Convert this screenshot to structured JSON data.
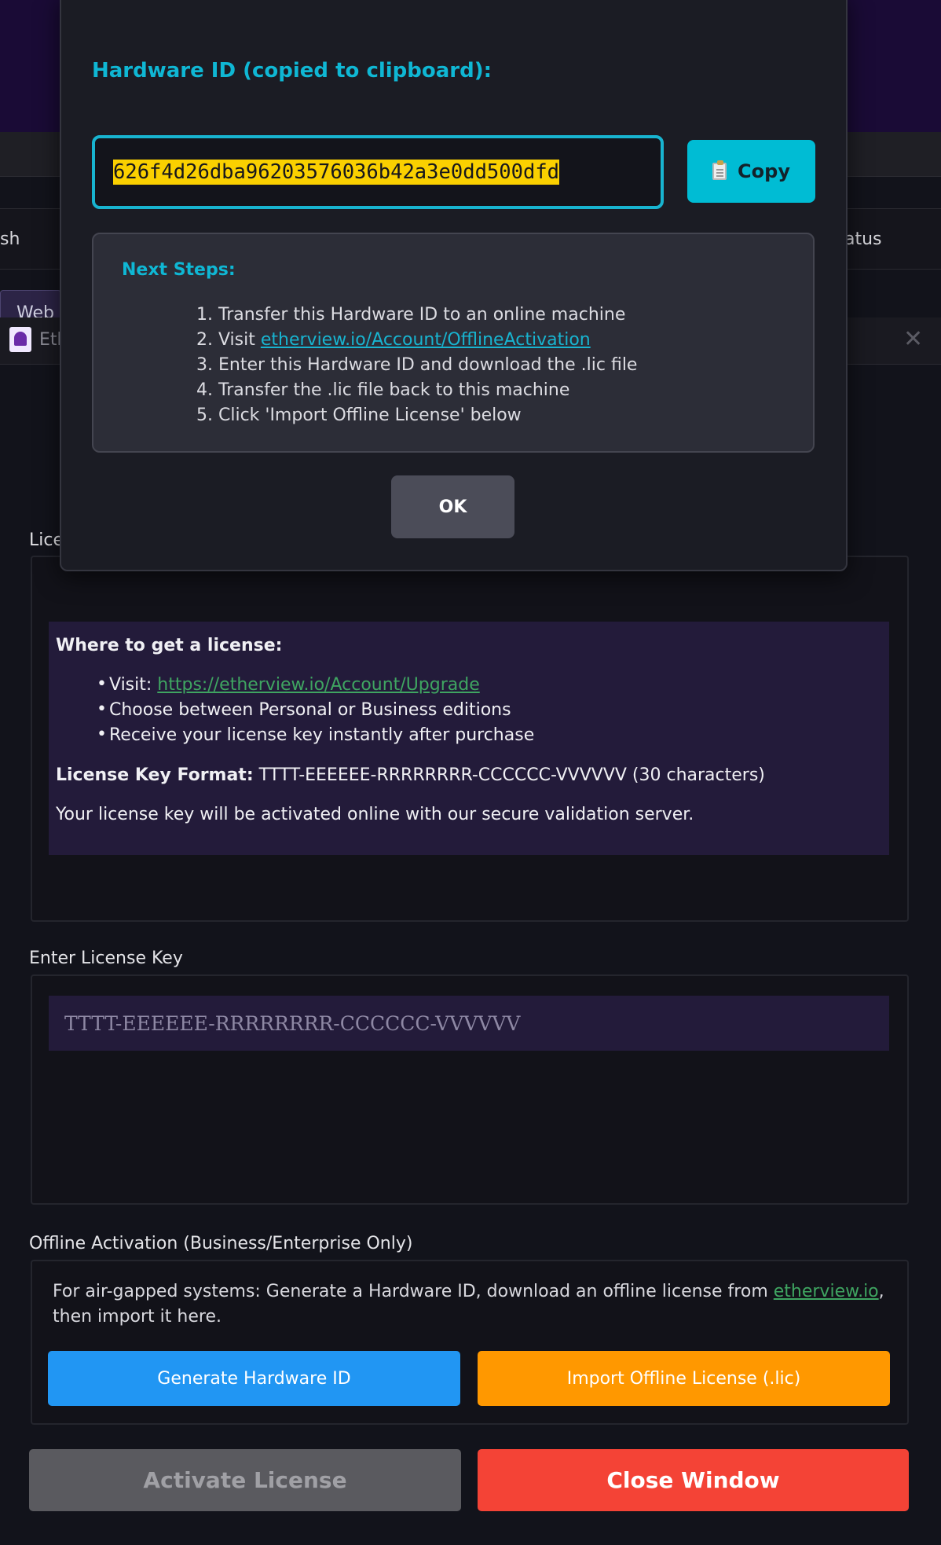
{
  "background": {
    "tab_left_fragment": "sh",
    "tab_right_fragment": "atus",
    "web_tab_fragment": "Web",
    "window_title_fragment": "Eth",
    "license_label_fragment": "Lice"
  },
  "info": {
    "heading": "Where to get a license:",
    "bullets": {
      "visit_prefix": "Visit: ",
      "visit_link": "https://etherview.io/Account/Upgrade",
      "choose": "Choose between Personal or Business editions",
      "receive": "Receive your license key instantly after purchase"
    },
    "format_label": "License Key Format:",
    "format_value": " TTTT-EEEEEE-RRRRRRRR-CCCCCC-VVVVVV (30 characters)",
    "activation_note": "Your license key will be activated online with our secure validation server."
  },
  "enter_key": {
    "label": "Enter License Key",
    "placeholder": "TTTT-EEEEEE-RRRRRRRR-CCCCCC-VVVVVV"
  },
  "offline": {
    "label": "Offline Activation (Business/Enterprise Only)",
    "desc_before": "For air-gapped systems: Generate a Hardware ID, download an offline license from ",
    "desc_link": "etherview.io",
    "desc_after": ", then import it here.",
    "generate_button": "Generate Hardware ID",
    "import_button": "Import Offline License (.lic)"
  },
  "actions": {
    "activate_button": "Activate License",
    "close_button": "Close Window"
  },
  "dialog": {
    "title": "Hardware ID (copied to clipboard):",
    "hardware_id": "626f4d26dba96203576036b42a3e0dd500dfd",
    "copy_button": "Copy",
    "copy_icon": "clipboard-icon",
    "steps_title": "Next Steps:",
    "steps": {
      "s1": "1. Transfer this Hardware ID to an online machine",
      "s2_prefix": "2. Visit ",
      "s2_link": "etherview.io/Account/OfflineActivation",
      "s3": "3. Enter this Hardware ID and download the .lic file",
      "s4": "4. Transfer the .lic file back to this machine",
      "s5": "5. Click 'Import Offline License' below"
    },
    "ok_button": "OK"
  },
  "colors": {
    "accent_cyan": "#00bcd4",
    "hwid_highlight": "#fad000",
    "generate_blue": "#2196f3",
    "import_orange": "#ff9800",
    "close_red": "#f44336",
    "panel_purple": "#231b3a"
  }
}
